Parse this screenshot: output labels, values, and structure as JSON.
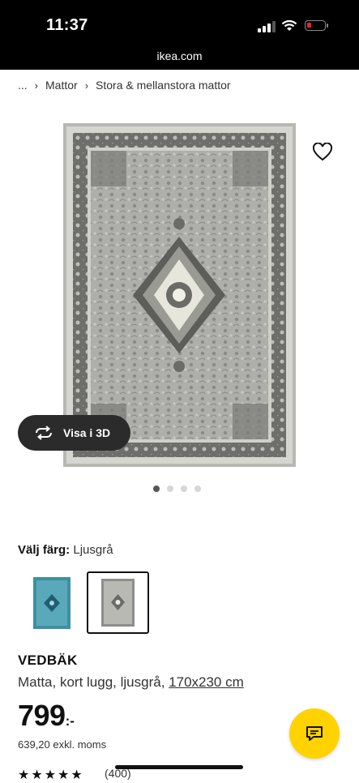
{
  "status_bar": {
    "time": "11:37",
    "url": "ikea.com"
  },
  "breadcrumb": {
    "ellipsis": "...",
    "items": [
      "Mattor",
      "Stora & mellanstora mattor"
    ]
  },
  "gallery": {
    "view_3d_label": "Visa i 3D",
    "dot_count": 4,
    "active_index": 0
  },
  "color": {
    "label": "Välj färg:",
    "value": "Ljusgrå",
    "swatches": [
      "blå",
      "ljusgrå"
    ],
    "selected": 1
  },
  "product": {
    "name": "VEDBÄK",
    "description": "Matta, kort lugg, ljusgrå,",
    "size": "170x230 cm",
    "price_main": "799",
    "price_suffix": ":-",
    "price_ex_vat": "639,20 exkl. moms",
    "rating": 4.5,
    "review_count": "(400)"
  },
  "colors": {
    "accent": "#ffd200",
    "dark": "#111111",
    "rug_grey": "#a9a9a4",
    "rug_blue": "#3f8fa3"
  },
  "icons": [
    "heart-icon",
    "rotate-3d-icon",
    "chat-icon",
    "star-icon"
  ]
}
